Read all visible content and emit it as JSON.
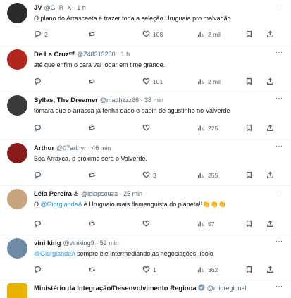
{
  "tweets": [
    {
      "name": "JV",
      "handle": "@G_R_X",
      "time": "1 h",
      "text_parts": [
        {
          "t": "O plano do Arrascaeta é trazer toda a seleção Uruguaia pro malvadão",
          "mention": false
        }
      ],
      "replies": "2",
      "retweets": "",
      "likes": "108",
      "views": "2 mil",
      "avatar_color": "#2b2b2b"
    },
    {
      "name": "De La Cruzᶜʳᶠ",
      "handle": "@Z48313250",
      "time": "1 h",
      "text_parts": [
        {
          "t": "até que enfim o cara vai jogar em time grande.",
          "mention": false
        }
      ],
      "replies": "",
      "retweets": "",
      "likes": "101",
      "views": "2 mil",
      "avatar_color": "#b3261e"
    },
    {
      "name": "Syllas, The Dreamer",
      "handle": "@matthzzz66",
      "time": "38 min",
      "text_parts": [
        {
          "t": "tomara que o arrasca já tenha dado o papin de agustinho no Valverde",
          "mention": false
        }
      ],
      "replies": "",
      "retweets": "",
      "likes": "",
      "views": "225",
      "avatar_color": "#3a3a3a"
    },
    {
      "name": "Arthur",
      "handle": "@07arthyr",
      "time": "46 min",
      "text_parts": [
        {
          "t": "Boa Arraxca, o próximo sera o Valverde.",
          "mention": false
        }
      ],
      "replies": "",
      "retweets": "",
      "likes": "3",
      "views": "255",
      "avatar_color": "#8b1a1a"
    },
    {
      "name": "Léia Pereira",
      "name_badge": "⚓",
      "handle": "@leiapsouza",
      "time": "25 min",
      "text_parts": [
        {
          "t": "O ",
          "mention": false
        },
        {
          "t": "@GiorgiandeA",
          "mention": true
        },
        {
          "t": " é Uruguaio mais flamenguista do planeta!!👏👏👏",
          "mention": false
        }
      ],
      "replies": "",
      "retweets": "",
      "likes": "",
      "views": "57",
      "avatar_color": "#c9a27e"
    },
    {
      "name": "vini king",
      "handle": "@viniking9",
      "time": "52 min",
      "text_parts": [
        {
          "t": "@GiorgiandeA",
          "mention": true
        },
        {
          "t": " sempre ele intermediando as negociações, ídolo",
          "mention": false
        }
      ],
      "replies": "",
      "retweets": "",
      "likes": "1",
      "views": "362",
      "avatar_color": "#6f8aa6"
    },
    {
      "name": "Ministério da Integração/Desenvolvimento Regiona",
      "handle": "@midregional",
      "time": "",
      "text_parts": [],
      "replies": "",
      "retweets": "",
      "likes": "",
      "views": "",
      "avatar_color": "#e8b100"
    }
  ],
  "colors": {
    "text": "#0f1419",
    "muted": "#536471",
    "mention": "#1d9bf0",
    "divider": "#eff3f4",
    "verified": "#829aab"
  },
  "icons": {
    "reply": "reply-icon",
    "retweet": "retweet-icon",
    "like": "heart-icon",
    "views": "views-icon",
    "more": "more-icon",
    "bookmark": "bookmark-icon"
  }
}
